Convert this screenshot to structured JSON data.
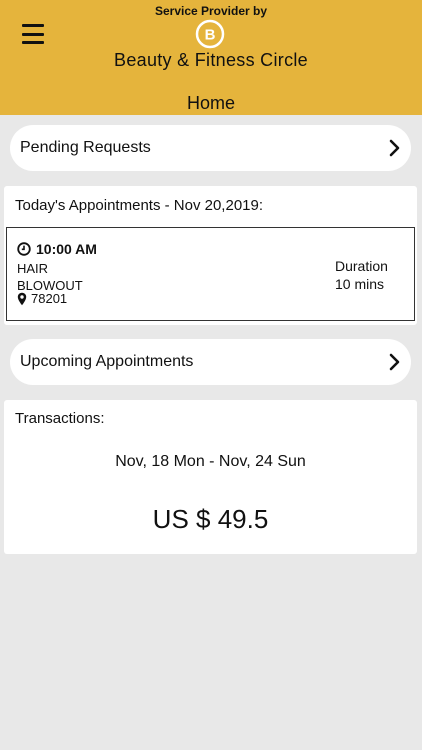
{
  "header": {
    "provider_label": "Service Provider by",
    "brand_name": "Beauty & Fitness Circle",
    "logo_letter": "B",
    "page_title": "Home",
    "accent_color": "#e5b43c"
  },
  "pending_requests": {
    "label": "Pending Requests"
  },
  "todays_appointments": {
    "title": "Today's Appointments - Nov 20,2019:",
    "items": [
      {
        "time": "10:00 AM",
        "service_line_1": "HAIR",
        "service_line_2": "BLOWOUT",
        "zip": "78201",
        "duration_label": "Duration",
        "duration_value": "10 mins"
      }
    ]
  },
  "upcoming_appointments": {
    "label": "Upcoming Appointments"
  },
  "transactions": {
    "title": "Transactions:",
    "date_range": "Nov, 18 Mon - Nov, 24 Sun",
    "amount": "US $ 49.5"
  },
  "icons": {
    "menu": "hamburger-menu-icon",
    "chevron": "chevron-right-icon",
    "clock": "clock-icon",
    "location": "location-pin-icon"
  }
}
